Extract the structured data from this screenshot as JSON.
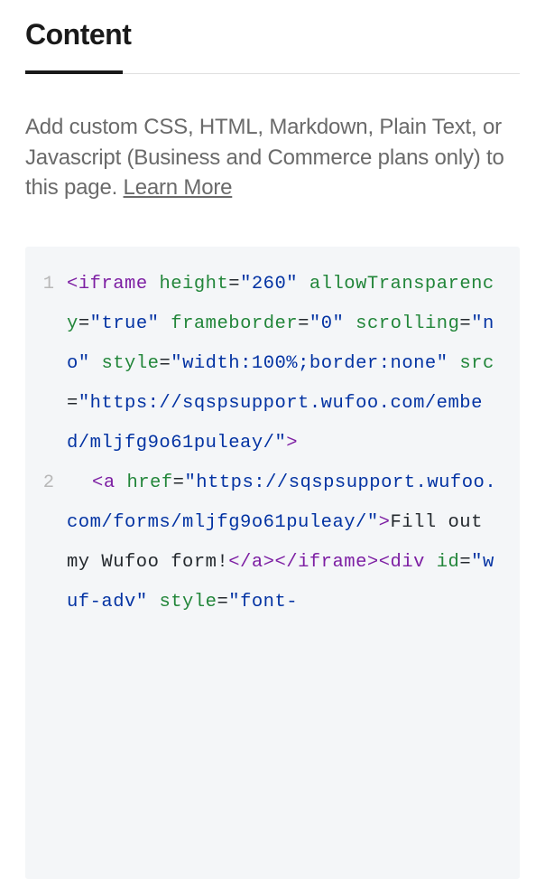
{
  "header": {
    "title": "Content"
  },
  "description": {
    "text_prefix": "Add custom CSS, HTML, Markdown, Plain Text, or Javascript (Business and Commerce plans only) to this page. ",
    "learn_more": "Learn More"
  },
  "code": {
    "line1_num": "1",
    "line2_num": "2",
    "tokens": {
      "iframe_open_lt": "<",
      "iframe_open_tag": "iframe",
      "space": " ",
      "attr_height": "height",
      "eq": "=",
      "val_height_q": "\"",
      "val_height": "260",
      "attr_allowtrans": "allowTransparency",
      "val_allowtrans": "true",
      "attr_frameborder": "frameborder",
      "val_frameborder": "0",
      "attr_scrolling": "scrolling",
      "val_scrolling": "no",
      "attr_style": "style",
      "val_style": "width:100%;border:none",
      "attr_src": "src",
      "val_src": "https://sqspsupport.wufoo.com/embed/mljfg9o61puleay/",
      "gt": ">",
      "a_open_lt": "<",
      "a_tag": "a",
      "attr_href": "href",
      "val_href": "https://sqspsupport.wufoo.com/forms/mljfg9o61puleay/",
      "a_text": "Fill out my Wufoo form!",
      "a_close": "</a>",
      "iframe_close_lt": "<",
      "iframe_close_slash": "/",
      "iframe_close_tag": "iframe",
      "div_open_lt": "<",
      "div_tag": "div",
      "attr_id": "id",
      "val_id": "wuf-adv",
      "val_style2": "font-"
    }
  }
}
